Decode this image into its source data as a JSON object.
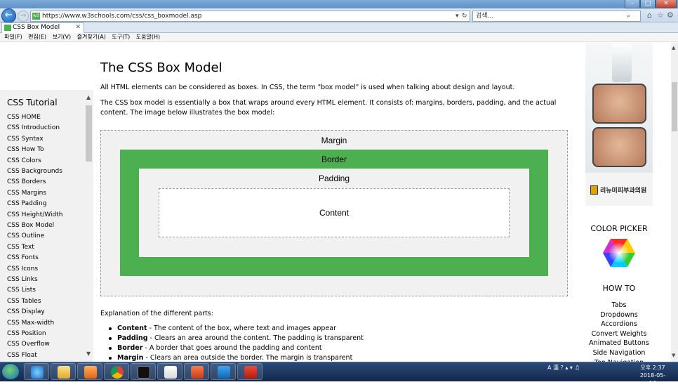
{
  "browser": {
    "url": "https://www.w3schools.com/css/css_boxmodel.asp",
    "search_placeholder": "검색...",
    "tab_title": "CSS Box Model",
    "menu": [
      "파일(F)",
      "편집(E)",
      "보기(V)",
      "즐겨찾기(A)",
      "도구(T)",
      "도움말(H)"
    ]
  },
  "sidebar": {
    "title": "CSS Tutorial",
    "items": [
      "CSS HOME",
      "CSS Introduction",
      "CSS Syntax",
      "CSS How To",
      "CSS Colors",
      "CSS Backgrounds",
      "CSS Borders",
      "CSS Margins",
      "CSS Padding",
      "CSS Height/Width",
      "CSS Box Model",
      "CSS Outline",
      "CSS Text",
      "CSS Fonts",
      "CSS Icons",
      "CSS Links",
      "CSS Lists",
      "CSS Tables",
      "CSS Display",
      "CSS Max-width",
      "CSS Position",
      "CSS Overflow",
      "CSS Float"
    ]
  },
  "main": {
    "title": "The CSS Box Model",
    "p1": "All HTML elements can be considered as boxes. In CSS, the term \"box model\" is used when talking about design and layout.",
    "p2a": "The CSS box model is essentially a box that wraps around every HTML element. It consists of: margins, borders, padding, and the actual",
    "p2b": "content. The image below illustrates the box model:",
    "diagram": {
      "margin": "Margin",
      "border": "Border",
      "padding": "Padding",
      "content": "Content"
    },
    "explanation": "Explanation of the different parts:",
    "parts": [
      {
        "term": "Content",
        "desc": " - The content of the box, where text and images appear"
      },
      {
        "term": "Padding",
        "desc": " - Clears an area around the content. The padding is transparent"
      },
      {
        "term": "Border",
        "desc": " - A border that goes around the padding and content"
      },
      {
        "term": "Margin",
        "desc": " - Clears an area outside the border. The margin is transparent"
      }
    ]
  },
  "right": {
    "ad_brand": "리뉴미피부과의원",
    "color_picker": "COLOR PICKER",
    "how_to": "HOW TO",
    "how_links": [
      "Tabs",
      "Dropdowns",
      "Accordions",
      "Convert Weights",
      "Animated Buttons",
      "Side Navigation",
      "Top Navigation"
    ]
  },
  "taskbar": {
    "ampm": "오후 2:37",
    "date": "2018-05-16",
    "ime": "A 漢"
  },
  "colors": {
    "green": "#4caf50",
    "box_gray": "#f1f1f1",
    "taskbar": "#1d3660"
  }
}
